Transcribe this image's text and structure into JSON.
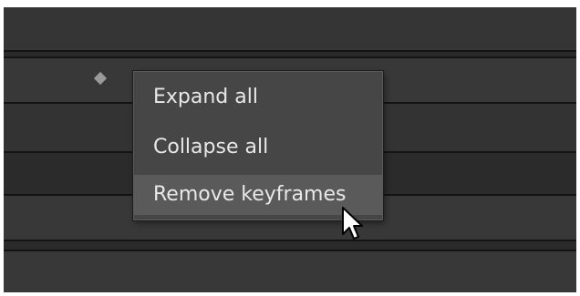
{
  "context_menu": {
    "items": [
      {
        "label": "Expand all",
        "state": "normal"
      },
      {
        "label": "Collapse all",
        "state": "normal"
      },
      {
        "label": "Remove keyframes",
        "state": "hover"
      }
    ]
  },
  "timeline": {
    "keyframe_icon": "diamond-icon"
  },
  "colors": {
    "panel_background": "#2d2d2d",
    "row_background": "#383838",
    "row_separator": "#141414",
    "menu_background": "#464646",
    "menu_hover": "#5a5a5a",
    "menu_text": "#e8e8e8"
  },
  "cursor": "arrow-pointer-icon"
}
